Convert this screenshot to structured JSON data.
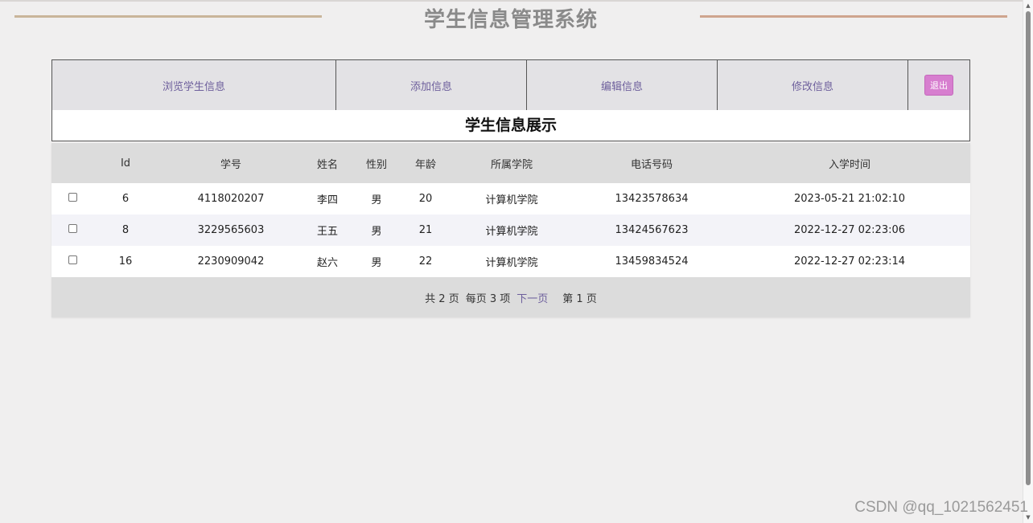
{
  "header": {
    "title": "学生信息管理系统"
  },
  "nav": {
    "browse": "浏览学生信息",
    "add": "添加信息",
    "edit": "编辑信息",
    "modify": "修改信息",
    "exit": "退出"
  },
  "section": {
    "title": "学生信息展示"
  },
  "table": {
    "columns": [
      "Id",
      "学号",
      "姓名",
      "性别",
      "年龄",
      "所属学院",
      "电话号码",
      "入学时间"
    ],
    "rows": [
      {
        "id": "6",
        "student_no": "4118020207",
        "name": "李四",
        "gender": "男",
        "age": "20",
        "college": "计算机学院",
        "phone": "13423578634",
        "enrolled": "2023-05-21 21:02:10"
      },
      {
        "id": "8",
        "student_no": "3229565603",
        "name": "王五",
        "gender": "男",
        "age": "21",
        "college": "计算机学院",
        "phone": "13424567623",
        "enrolled": "2022-12-27 02:23:06"
      },
      {
        "id": "16",
        "student_no": "2230909042",
        "name": "赵六",
        "gender": "男",
        "age": "22",
        "college": "计算机学院",
        "phone": "13459834524",
        "enrolled": "2022-12-27 02:23:14"
      }
    ]
  },
  "pager": {
    "total": "共 2 页",
    "per_page": "每页 3 项",
    "next": "下一页",
    "current": "第 1 页"
  },
  "watermark": "CSDN @qq_1021562451"
}
